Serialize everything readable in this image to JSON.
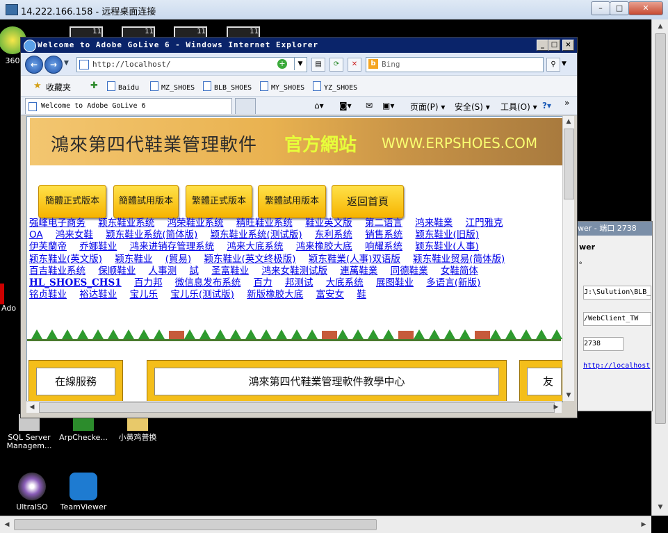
{
  "rdp": {
    "title": "14.222.166.158 - 远程桌面连接",
    "min": "–",
    "max": "□",
    "close": "✕"
  },
  "desktop": {
    "icons": [
      {
        "label": "360",
        "name": "360-icon"
      },
      {
        "label": "SQL Server Managem...",
        "name": "sql-server-icon"
      },
      {
        "label": "ArpChecke...",
        "name": "arpchecker-icon"
      },
      {
        "label": "小黄鸡普换",
        "name": "folder-icon"
      },
      {
        "label": "UltraISO",
        "name": "ultraiso-icon"
      },
      {
        "label": "TeamViewer",
        "name": "teamviewer-icon"
      },
      {
        "label": "Ado",
        "name": "adobe-icon"
      }
    ],
    "thumb_label": "11"
  },
  "bgwin": {
    "title": "wer - 端口 2738",
    "line1": "wer",
    "line2": "。",
    "path": "J:\\Sulution\\BLB_",
    "vpath": "/WebClient_TW",
    "port": "2738",
    "link": "http://localhost"
  },
  "ie": {
    "title": "Welcome to Adobe GoLive 6 - Windows Internet Explorer",
    "address": "http://localhost/",
    "search_placeholder": "Bing",
    "favorites_label": "收藏夹",
    "fav_links": [
      "Baidu",
      "MZ_SHOES",
      "BLB_SHOES",
      "MY_SHOES",
      "YZ_SHOES"
    ],
    "tab_title": "Welcome to Adobe GoLive 6",
    "commands": {
      "page": "页面(P)",
      "safety": "安全(S)",
      "tools": "工具(O)"
    }
  },
  "page": {
    "banner_cn": "鴻來第四代鞋業管理軟件",
    "banner_site": "官方網站",
    "banner_url": "WWW.ERPSHOES.COM",
    "buttons": [
      "簡體正式版本",
      "簡體試用版本",
      "繁體正式版本",
      "繁體試用版本",
      "返回首頁"
    ],
    "links": [
      "强峰电子商务",
      "颖东鞋业系统",
      "鸿荣鞋业系统",
      "精旺鞋业系统",
      "鞋业英文版",
      "第二语言",
      "鸿来鞋業",
      "江門雅克",
      "OA",
      "鸿来女鞋",
      "颖东鞋业系统(简体版)",
      "颖东鞋业系统(测试版)",
      "东利系统",
      "销售系统",
      "颖东鞋业(旧版)",
      "伊芙蘭帝",
      "乔娜鞋业",
      "鸿来进销存管理系统",
      "鸿来大底系统",
      "鸿来橡胶大底",
      "响耀系统",
      "颖东鞋业(人事)",
      "颖东鞋业(英文版)",
      "颖东鞋业",
      "(貿易)",
      "颖东鞋业(英文终极版)",
      "颖东鞋業(人事)双语版",
      "颖东鞋业贸易(简体版)",
      "百吉鞋业系统",
      "保顺鞋业",
      "人事测",
      "試",
      "圣富鞋业",
      "鸿来女鞋测试版",
      "連萬鞋業",
      "同德鞋業",
      "女鞋简体",
      "HL_SHOES_CHS1",
      "百力邦",
      "微信息发布系统",
      "百力",
      "邦测试",
      "大底系统",
      "展图鞋业",
      "多语言(新版)",
      "铭贞鞋业",
      "裕达鞋业",
      "宝儿乐",
      "宝儿乐(测试版)",
      "新版橡胶大底",
      "富安女",
      "鞋"
    ],
    "plank_left": "在線服務",
    "plank_center": "鴻來第四代鞋業管理軟件教學中心",
    "plank_right": "友誼"
  }
}
